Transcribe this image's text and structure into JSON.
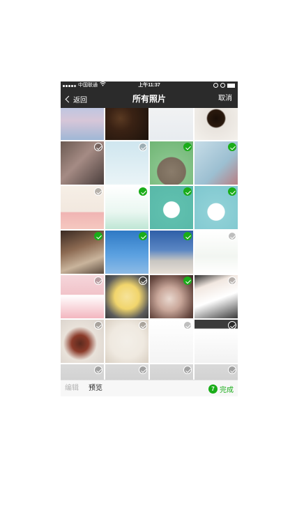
{
  "status_bar": {
    "carrier": "中国联通",
    "time": "上午11:37",
    "signal_icon": "signal-dots-icon",
    "wifi_icon": "wifi-icon",
    "battery_icon": "battery-icon"
  },
  "nav": {
    "back_label": "返回",
    "title": "所有照片",
    "cancel_label": "取消"
  },
  "photos": [
    {
      "subject": "sky",
      "selected": false
    },
    {
      "subject": "coffee-beans",
      "selected": false
    },
    {
      "subject": "document",
      "selected": false
    },
    {
      "subject": "coffee-cup",
      "selected": false
    },
    {
      "subject": "hand-photo",
      "selected": false
    },
    {
      "subject": "cartoon-character",
      "selected": false
    },
    {
      "subject": "totoro",
      "selected": true
    },
    {
      "subject": "illustration-girl",
      "selected": true
    },
    {
      "subject": "pink-whale",
      "selected": false
    },
    {
      "subject": "green-drink-drawing",
      "selected": true
    },
    {
      "subject": "bunny-teacup",
      "selected": true
    },
    {
      "subject": "cat-teacup",
      "selected": true
    },
    {
      "subject": "street-scene",
      "selected": true
    },
    {
      "subject": "blue-sky-tree",
      "selected": true
    },
    {
      "subject": "girl-at-sea",
      "selected": true
    },
    {
      "subject": "floral-sketch",
      "selected": false
    },
    {
      "subject": "pink-houses",
      "selected": false
    },
    {
      "subject": "yellow-duck",
      "selected": false
    },
    {
      "subject": "cat-photo",
      "selected": true
    },
    {
      "subject": "tickets",
      "selected": false
    },
    {
      "subject": "food-plate",
      "selected": false
    },
    {
      "subject": "coffee-bean-smiley",
      "selected": false
    },
    {
      "subject": "text-screenshot",
      "selected": false
    },
    {
      "subject": "chat-screenshot",
      "selected": false
    },
    {
      "subject": "partial",
      "selected": false
    },
    {
      "subject": "partial",
      "selected": false
    },
    {
      "subject": "partial",
      "selected": false
    },
    {
      "subject": "partial",
      "selected": false
    }
  ],
  "bottom": {
    "edit_label": "编辑",
    "preview_label": "预览",
    "selected_count": "7",
    "done_label": "完成"
  },
  "colors": {
    "accent": "#1aad19",
    "nav_bg": "#2b2b2b",
    "bottom_bg": "#f7f7f7"
  }
}
